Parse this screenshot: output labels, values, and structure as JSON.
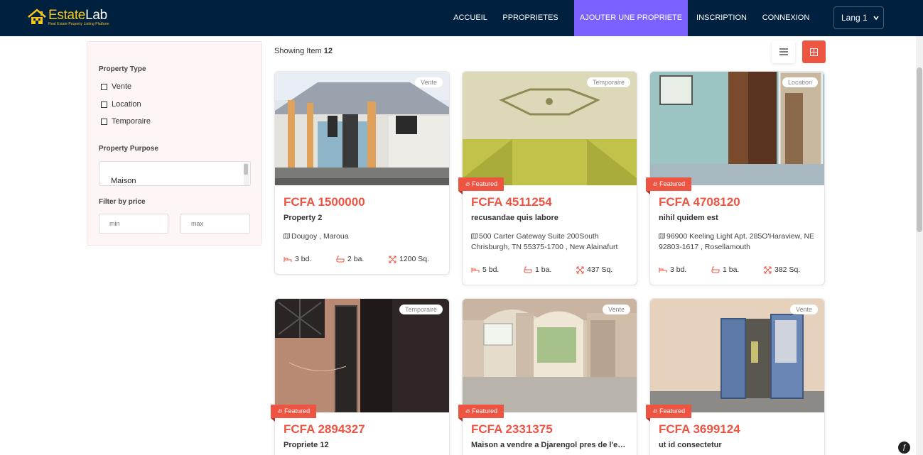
{
  "brand": {
    "name_a": "Estate",
    "name_b": "Lab",
    "tagline": "Real Estate Property Listing Platform"
  },
  "nav": {
    "items": [
      {
        "label": "ACCUEIL",
        "active": false
      },
      {
        "label": "PPROPRIETES",
        "active": false
      },
      {
        "label": "AJOUTER UNE PROPRIETE",
        "active": true
      },
      {
        "label": "INSCRIPTION",
        "active": false
      },
      {
        "label": "CONNEXION",
        "active": false
      }
    ],
    "lang": "Lang 1"
  },
  "sidebar": {
    "type_title": "Property Type",
    "types": [
      "Vente",
      "Location",
      "Temporaire"
    ],
    "purpose_title": "Property Purpose",
    "purpose_option": "Maison",
    "price_title": "Filter by price",
    "min_placeholder": "min",
    "max_placeholder": "max"
  },
  "results": {
    "showing_label": "Showing Item",
    "count": "12"
  },
  "featured_label": "Featured",
  "cards": [
    {
      "badge": "Vente",
      "featured": false,
      "price": "FCFA 1500000",
      "title": "Property 2",
      "address": "Dougoy , Maroua",
      "beds": "3 bd.",
      "baths": "2 ba.",
      "area": "1200 Sq."
    },
    {
      "badge": "Temporaire",
      "featured": true,
      "price": "FCFA 4511254",
      "title": "recusandae quis labore",
      "address": "500 Carter Gateway Suite 200South Chrisburgh, TN 55375-1700 , New Alainafurt",
      "beds": "5 bd.",
      "baths": "1 ba.",
      "area": "437 Sq."
    },
    {
      "badge": "Location",
      "featured": true,
      "price": "FCFA 4708120",
      "title": "nihil quidem est",
      "address": "96900 Keeling Light Apt. 285O'Haraview, NE 92803-1617 , Rosellamouth",
      "beds": "3 bd.",
      "baths": "1 ba.",
      "area": "382 Sq."
    },
    {
      "badge": "Temporaire",
      "featured": true,
      "price": "FCFA 2894327",
      "title": "Propriete 12"
    },
    {
      "badge": "Vente",
      "featured": true,
      "price": "FCFA 2331375",
      "title": "Maison a vendre a Djarengol pres de l'ecole"
    },
    {
      "badge": "Vente",
      "featured": true,
      "price": "FCFA 3699124",
      "title": "ut id consectetur"
    }
  ],
  "colors": {
    "navy": "#00203f",
    "accent": "#ee5442",
    "nav_active": "#7b61ff",
    "gold": "#f5c518"
  }
}
